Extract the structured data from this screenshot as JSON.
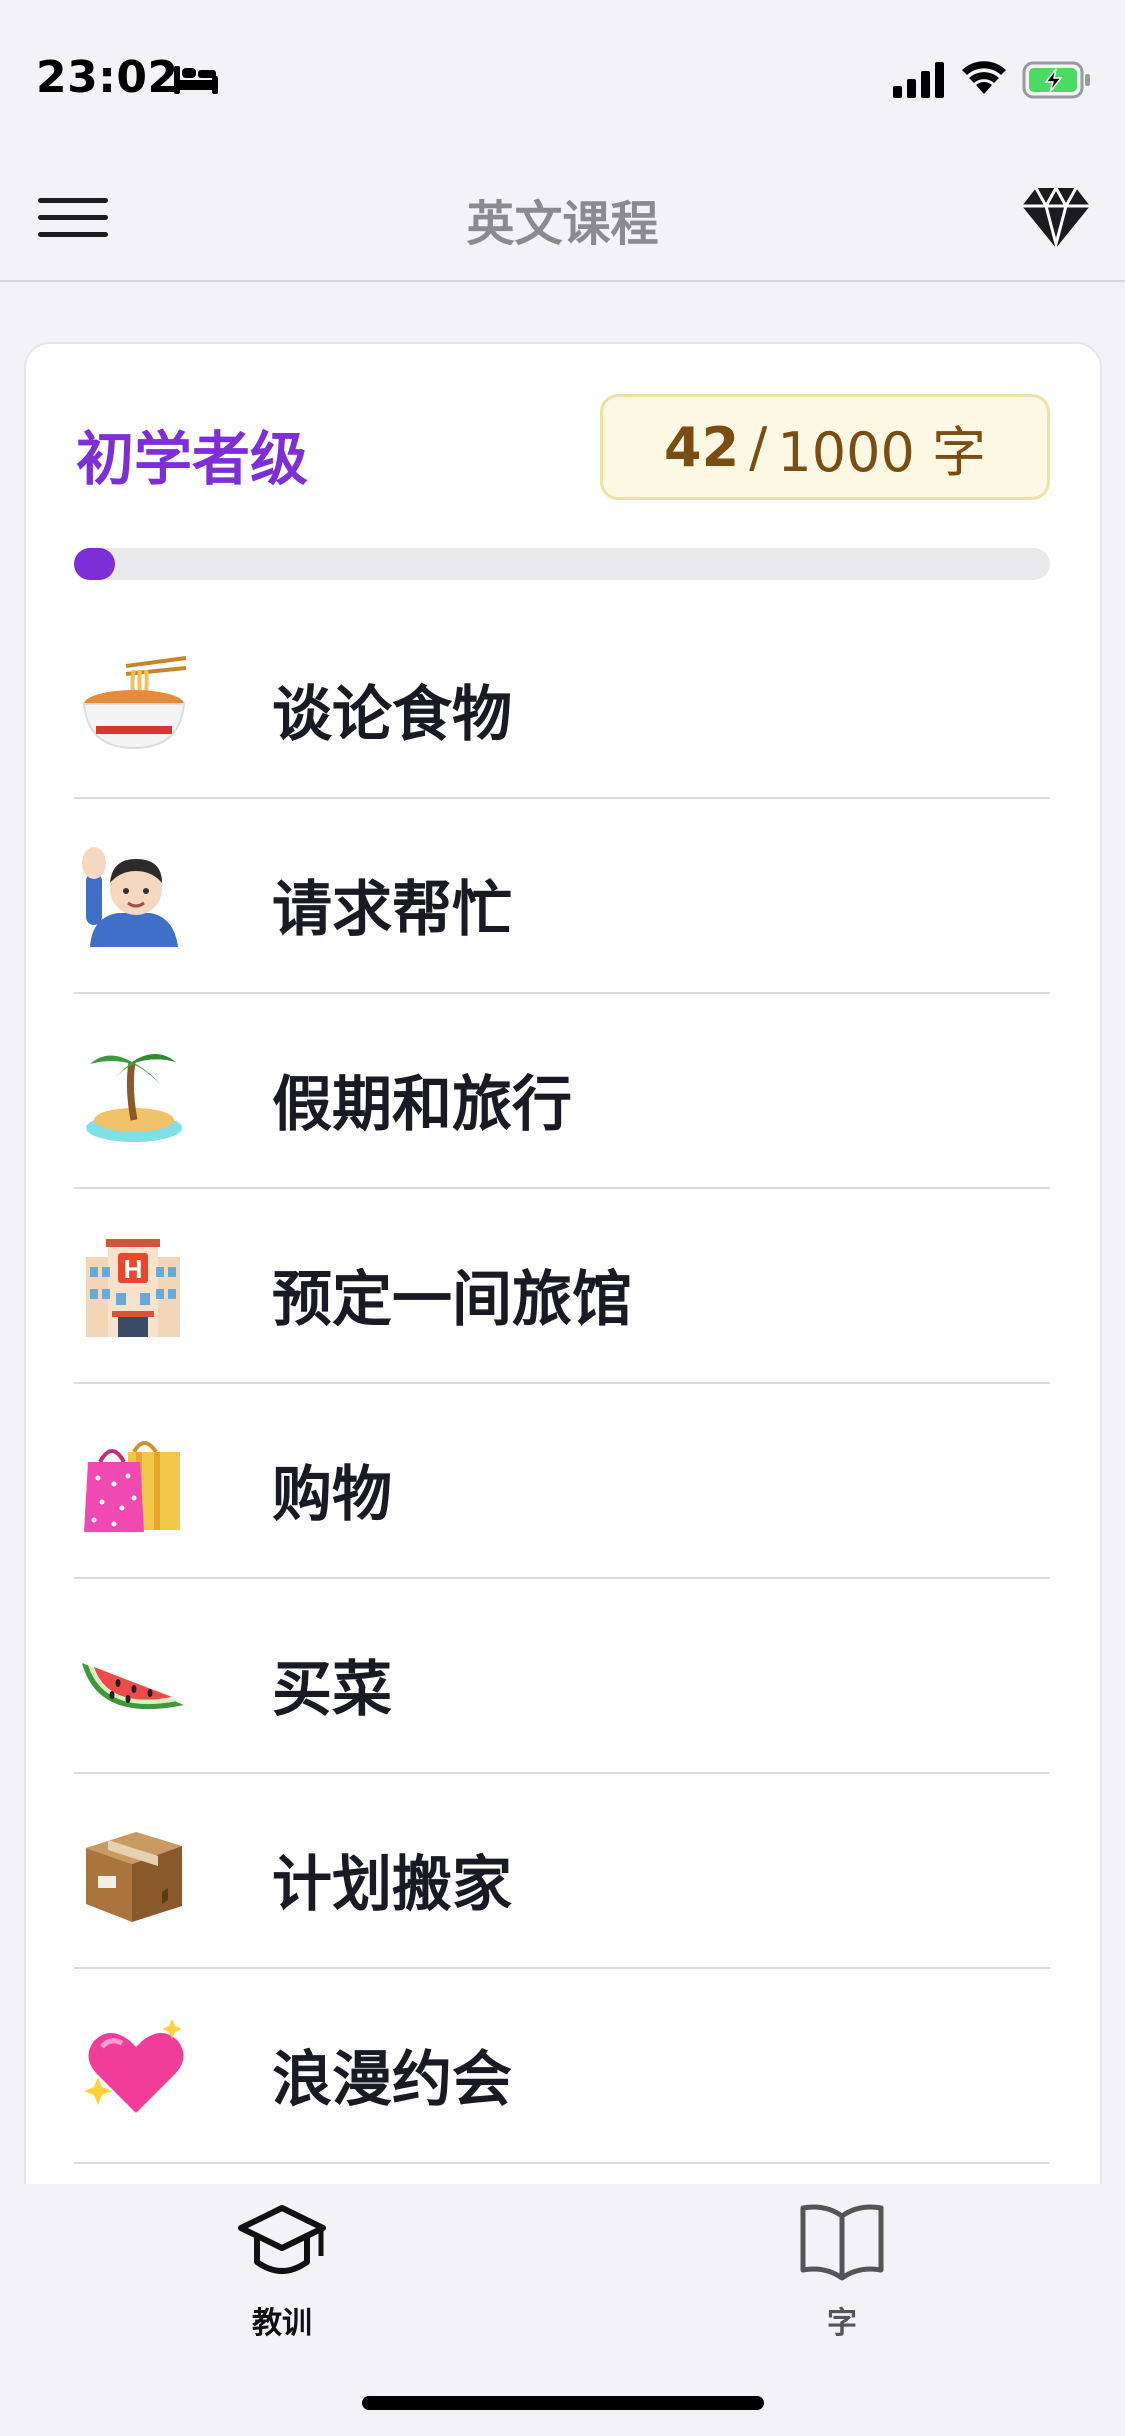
{
  "status_bar": {
    "time": "23:02",
    "focus_icon": "bed-icon",
    "signal_icon": "cellular-signal-icon",
    "wifi_icon": "wifi-icon",
    "battery_icon": "battery-charging-icon",
    "battery_color": "#4cd964"
  },
  "nav": {
    "title": "英文课程",
    "left_icon": "hamburger-menu-icon",
    "right_icon": "diamond-icon"
  },
  "course": {
    "level": "初学者级",
    "words_learned": "42",
    "separator": "/",
    "words_total": "1000 字",
    "progress_fraction": 0.042,
    "accent_color": "#7d2ed6"
  },
  "lessons": [
    {
      "title": "谈论食物",
      "icon": "noodle-bowl-icon"
    },
    {
      "title": "请求帮忙",
      "icon": "raising-hand-icon"
    },
    {
      "title": "假期和旅行",
      "icon": "desert-island-icon"
    },
    {
      "title": "预定一间旅馆",
      "icon": "hotel-icon"
    },
    {
      "title": "购物",
      "icon": "shopping-bags-icon"
    },
    {
      "title": "买菜",
      "icon": "watermelon-icon"
    },
    {
      "title": "计划搬家",
      "icon": "package-icon"
    },
    {
      "title": "浪漫约会",
      "icon": "sparkling-heart-icon"
    }
  ],
  "tabs": {
    "lessons_label": "教训",
    "lessons_icon": "graduation-cap-icon",
    "words_label": "字",
    "words_icon": "open-book-icon"
  }
}
